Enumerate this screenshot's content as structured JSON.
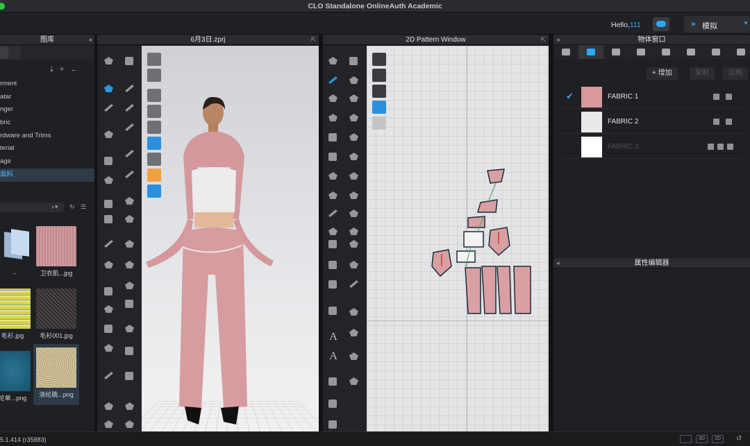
{
  "window": {
    "title": "CLO Standalone OnlineAuth Academic"
  },
  "topbar": {
    "hello_prefix": "Hello,",
    "user_id": "111",
    "mode_label": "模拟"
  },
  "library": {
    "header": "图库",
    "items": [
      {
        "label": "rment"
      },
      {
        "label": "atar"
      },
      {
        "label": "nger"
      },
      {
        "label": "bric"
      },
      {
        "label": "rdware and Trims"
      },
      {
        "label": "terial"
      },
      {
        "label": "age"
      },
      {
        "label": "面料"
      }
    ],
    "thumbnails": [
      {
        "caption": "..",
        "kind": "folder"
      },
      {
        "caption": "卫衣肌...jpg",
        "color": "#c48d92"
      },
      {
        "caption": "毛衫.jpg",
        "color": "#d9d34a"
      },
      {
        "caption": "毛衫001.jpg",
        "color": "#3a3638"
      },
      {
        "caption": "纶单...png",
        "color": "#1b5e78"
      },
      {
        "caption": "涤纶跳...png",
        "color": "#c7b88a"
      }
    ]
  },
  "viewport3d": {
    "header": "6月3日.zprj"
  },
  "viewport2d": {
    "header": "2D Pattern Window"
  },
  "object_window": {
    "header": "物体窗口",
    "add_label": "+ 增加",
    "copy_label": "复制",
    "apply_label": "应用",
    "fabrics": [
      {
        "name": "FABRIC 1",
        "color": "#d7999b",
        "selected": true
      },
      {
        "name": "FABRIC 2",
        "color": "#e9e9e9",
        "selected": false
      },
      {
        "name": "FABRIC 3",
        "color": "#ffffff",
        "selected": false,
        "dimmed": true
      }
    ]
  },
  "property_editor": {
    "header": "属性编辑器"
  },
  "status": {
    "version": "5.1.414 (r35883)",
    "view_buttons": [
      "",
      "3D",
      "2D"
    ]
  },
  "colors": {
    "accent": "#2aa9ff",
    "garment_pink": "#d99da0"
  }
}
